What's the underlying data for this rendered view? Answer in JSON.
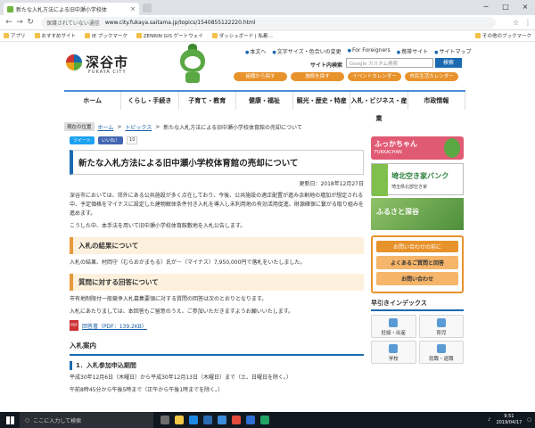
{
  "browser": {
    "tab_title": "新たな入札方法による旧中瀬小学校体",
    "tab_close": "×",
    "security_label": "保護されていない通信",
    "url": "www.city.fukaya.saitama.jp/topics/1540855122220.html",
    "window_controls": [
      "─",
      "□",
      "×"
    ],
    "bookmarks": [
      "アプリ",
      "おすすめサイト",
      "IE ブックマーク",
      "ZENRIN GIS ゲートウェイ",
      "ダッシュボード | 私都…"
    ],
    "other_bookmarks": "その他のブックマーク"
  },
  "header": {
    "logo_name": "深谷市",
    "logo_roman": "FUKAYA CITY",
    "util_links": [
      "本文へ",
      "文字サイズ・色合いの変更",
      "For Foreigners",
      "携帯サイト",
      "サイトマップ"
    ],
    "search_label": "サイト内検索",
    "search_placeholder": "Google カスタム検索",
    "search_button": "検索",
    "quick_buttons": [
      "組織から探す",
      "施設を探す",
      "イベントカレンダー",
      "市民生活カレンダー"
    ]
  },
  "gnav": [
    "ホーム",
    "くらし・手続き",
    "子育て・教育",
    "健康・福祉",
    "観光・歴史・特産",
    "入札・ビジネス・産業",
    "市政情報"
  ],
  "breadcrumb": {
    "here": "現在の位置",
    "home": "ホーム",
    "topics": "トピックス",
    "current": "新たな入札方法による旧中瀬小学校体育館の売却について"
  },
  "social": {
    "tweet": "ツイート",
    "like": "いいね！",
    "like_count": "10"
  },
  "article": {
    "title": "新たな入札方法による旧中瀬小学校体育館の売却について",
    "updated": "更新日：2018年12月27日",
    "intro1": "深谷市においては、郊外にある公共施設が多く点在しており、今後、公共施設の適正配置が進み余剰地の増加が想定される中、予定価格をマイナスに設定した建物解体条件付き入札を導入し未利用地の有効活用促進、財源確保に繋がる取り組みを進めます。",
    "intro2": "こうした中、本手法を用いて旧中瀬小学校体育館敷地を入札公告します。",
    "h_result": "入札の結果について",
    "result_text": "入札の結果、村岡守（むらおかまもる）氏が－（マイナス）7,950,000円で落札をいたしました。",
    "h_qa": "質問に対する回答について",
    "qa_text1": "市有地制限付一般競争入札募集要領に対する質問の回答は次のとおりとなります。",
    "qa_text2": "入札にあたりましては、本回答もご留意のうえ、ご参加いただきますようお願いいたします。",
    "pdf_link": "回答書（PDF：139.2KB）",
    "h_guide": "入札案内",
    "h_step1": "1．入札参加申込期間",
    "step1_text1": "平成30年12月6日（木曜日）から平成30年12月13日（木曜日）まで（土、日曜日を除く。）",
    "step1_text2": "午前8時45分から午後5時まで（正午から午後1時までを除く。）"
  },
  "sidebar": {
    "fukka_title": "ふっかちゃん",
    "fukka_sub": "FUKKACHAN",
    "akiya_title": "埼北空き家バンク",
    "akiya_sub": "埼玉県北部空き家",
    "photo_text": "ふるさと深谷",
    "inquiry_head": "お問い合わせの前に",
    "faq_button": "よくあるご質問と回答",
    "contact_button": "お問い合わせ",
    "index_head": "早引きインデックス",
    "index_items": [
      "妊娠・出産",
      "育児",
      "学校",
      "就職・退職"
    ]
  },
  "taskbar": {
    "search_placeholder": "ここに入力して検索",
    "time": "9:51",
    "date": "2019/04/17"
  }
}
